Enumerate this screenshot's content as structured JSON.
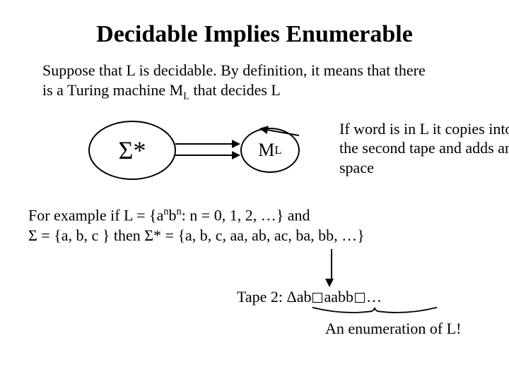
{
  "title": "Decidable Implies Enumerable",
  "intro_line1": "Suppose that L is decidable. By definition, it means that there",
  "intro_line2_a": "is a Turing machine M",
  "intro_line2_b": " that decides L",
  "sigma_label": "Σ*",
  "ml_label_M": "M",
  "ml_label_L": "L",
  "annotation": "If word is in L it copies into the second tape and adds an space",
  "example_line1_a": "For example if L = {a",
  "example_line1_b": "b",
  "example_line1_c": ": n = 0, 1, 2, …} and",
  "example_line2": "Σ = {a,  b, c } then Σ* = {a,  b, c, aa, ab, ac, ba, bb, …}",
  "tape2_prefix": "Tape 2: Δab",
  "tape2_mid": "aabb",
  "tape2_suffix": "…",
  "enumeration": "An enumeration of L!"
}
